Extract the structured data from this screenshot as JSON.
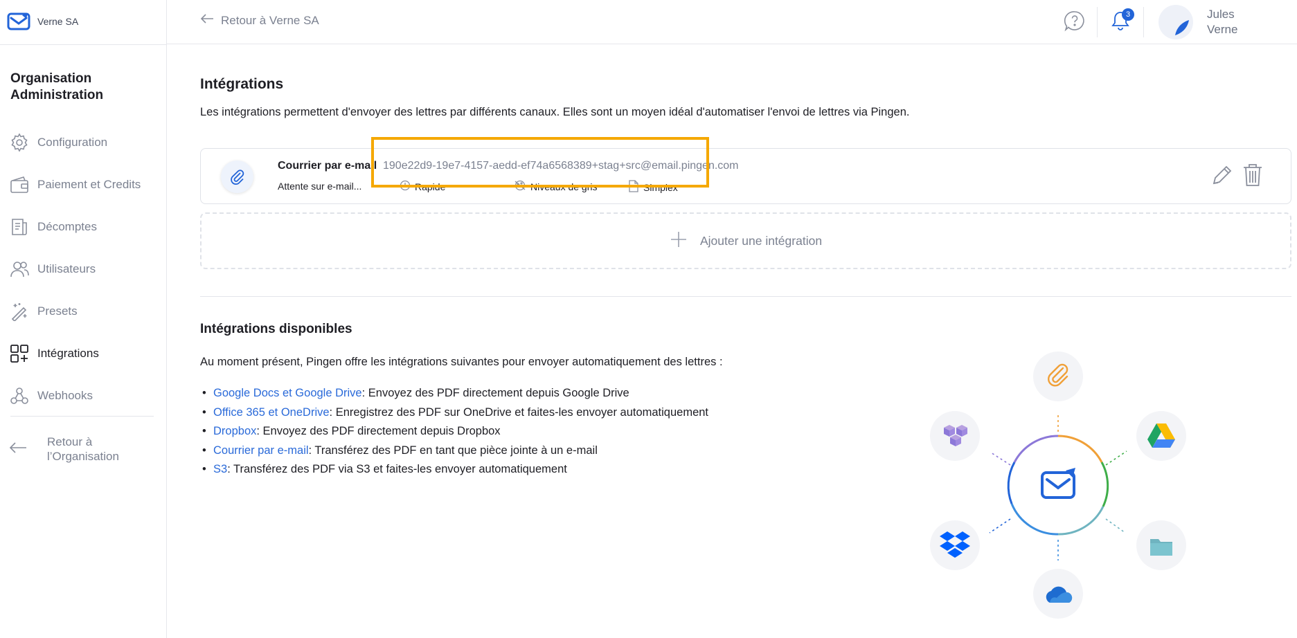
{
  "brand": {
    "name": "Verne SA",
    "logo_icon": "mail-logo-icon",
    "accent": "#2264d8"
  },
  "sidebar": {
    "title": "Organisation Administration",
    "items": [
      {
        "label": "Configuration",
        "icon": "gear-icon",
        "active": false
      },
      {
        "label": "Paiement et Credits",
        "icon": "wallet-icon",
        "active": false
      },
      {
        "label": "Décomptes",
        "icon": "invoice-icon",
        "active": false
      },
      {
        "label": "Utilisateurs",
        "icon": "users-icon",
        "active": false
      },
      {
        "label": "Presets",
        "icon": "magic-wand-icon",
        "active": false
      },
      {
        "label": "Intégrations",
        "icon": "integrations-icon",
        "active": true
      },
      {
        "label": "Webhooks",
        "icon": "webhook-icon",
        "active": false
      }
    ],
    "back_label": "Retour à l’Organisation"
  },
  "header": {
    "back_label": "Retour à Verne SA",
    "notifications_count": "3",
    "user_name": "Jules Verne"
  },
  "main": {
    "title": "Intégrations",
    "intro": "Les intégrations permettent d'envoyer des lettres par différents canaux. Elles sont un moyen idéal d'automatiser l'envoi de lettres via Pingen.",
    "integration": {
      "title": "Courrier par e-mail",
      "email": "190e22d9-19e7-4157-aedd-ef74a6568389+stag+src@email.pingen.com",
      "status": "Attente sur e-mail...",
      "tags": [
        "Rapide",
        "Niveaux de gris",
        "Simplex"
      ]
    },
    "add_label": "Ajouter une intégration",
    "available_title": "Intégrations disponibles",
    "available_lead": "Au moment présent, Pingen offre les intégrations suivantes pour envoyer automatiquement des lettres :",
    "available": [
      {
        "link": "Google Docs et Google Drive",
        "text": " : Envoyez des PDF directement depuis Google Drive"
      },
      {
        "link": "Office 365 et OneDrive",
        "text": " : Enregistrez des PDF sur OneDrive et faites-les envoyer automatiquement"
      },
      {
        "link": "Dropbox",
        "text": " : Envoyez des PDF directement depuis Dropbox"
      },
      {
        "link": "Courrier par e-mail",
        "text": " : Transférez des PDF en tant que pièce jointe à un e-mail"
      },
      {
        "link": "S3",
        "text": " : Transférez des PDF via S3 et faites-les envoyer automatiquement"
      }
    ],
    "highlight_color": "#f5a800"
  }
}
